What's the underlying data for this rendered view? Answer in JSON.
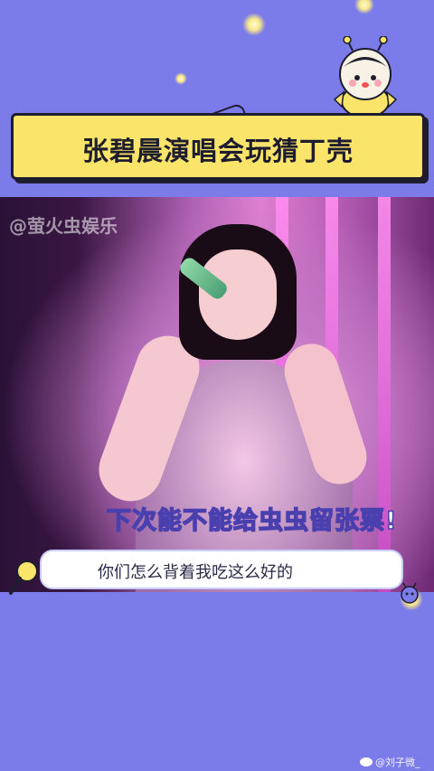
{
  "title": "张碧晨演唱会玩猜丁壳",
  "video": {
    "watermark": "@萤火虫娱乐",
    "caption_top": "下次能不能给虫虫留张票!"
  },
  "subtitle": "你们怎么背着我吃这么好的",
  "footer": {
    "credit": "@刘子微_"
  },
  "colors": {
    "background": "#7b7ce9",
    "title_card": "#fbe46a",
    "outline": "#1d1d2f"
  }
}
